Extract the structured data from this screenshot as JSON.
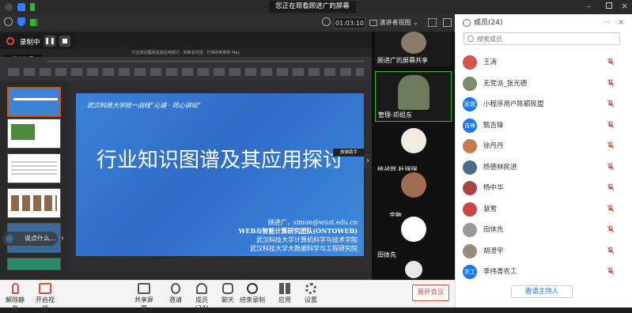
{
  "top": {
    "banner": "您正在观看顾进广的屏幕",
    "timer": "01:03:10",
    "view_mode": "演讲者视图"
  },
  "recording": {
    "label": "录制中"
  },
  "ppt": {
    "title": "行业知识图谱及其应用探讨 - 知新会交流  ·  已保存到我的 Mac",
    "pin_label": "锁定演示"
  },
  "slide": {
    "header": "武汉科技大学统一战线“沁湖 · 同心讲坛”",
    "title": "行业知识图谱及其应用探讨",
    "author": "顾进广，simon@wust.edu.cn",
    "lines": [
      "WEB与智能计算研究团队(ONTOWEB)",
      "武汉科技大学计算机科学与技术学院",
      "武汉科技大学大数据科学与工程研究院"
    ],
    "float_badge": "放映助手"
  },
  "thumb_overlay": "说点什么...",
  "gallery": [
    {
      "name": "顾进广的屏幕共享",
      "bg": "#8a7a66"
    },
    {
      "name": "管理-邓组东",
      "bg": "#6f7a5a"
    },
    {
      "name": "统战部 杜瑞瑞",
      "bg": "#ffffff"
    },
    {
      "name": "余敏",
      "bg": "#a06b4e"
    },
    {
      "name": "田体先",
      "bg": "#ffffff"
    },
    {
      "name": "",
      "bg": "#e8e8e8"
    }
  ],
  "members": {
    "title": "成员(24)",
    "search_placeholder": "搜索成员",
    "list": [
      {
        "name": "王涛",
        "avatar": "",
        "color": "#d9534f"
      },
      {
        "name": "无党派_张光德",
        "avatar": "",
        "color": "#7b8a6a"
      },
      {
        "name": "小程序用户陈颖民盟",
        "avatar": "民盟",
        "color": "#1677ff"
      },
      {
        "name": "甄吉锋",
        "avatar": "吉锋",
        "color": "#1677ff"
      },
      {
        "name": "徐丹丹",
        "avatar": "",
        "color": "#c77b4a"
      },
      {
        "name": "杨德林民进",
        "avatar": "",
        "color": "#4a6b8a"
      },
      {
        "name": "杨中华",
        "avatar": "",
        "color": "#a44"
      },
      {
        "name": "慧雪",
        "avatar": "",
        "color": "#c44"
      },
      {
        "name": "田体先",
        "avatar": "",
        "color": "#999"
      },
      {
        "name": "胡澄宇",
        "avatar": "",
        "color": "#9a8a7a"
      },
      {
        "name": "李纬青农工",
        "avatar": "农工",
        "color": "#1677ff"
      }
    ],
    "invite": "邀请主持人"
  },
  "toolbar": {
    "mute": "解除静音",
    "video": "开启视频",
    "share": "共享屏幕",
    "invite": "邀请",
    "members": "成员(24)",
    "chat": "聊天",
    "record": "结束录制",
    "apps": "应用",
    "settings": "设置",
    "leave": "离开会议"
  }
}
